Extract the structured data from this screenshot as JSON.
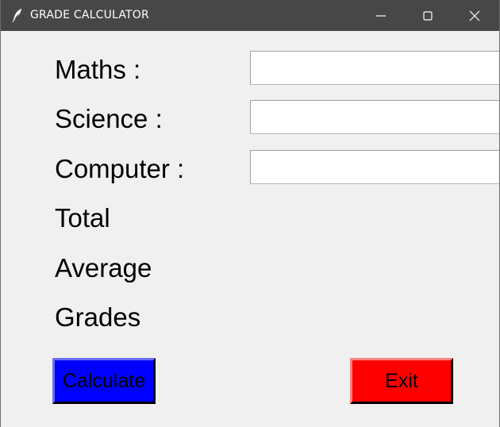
{
  "window": {
    "title": "GRADE CALCULATOR"
  },
  "form": {
    "maths_label": "Maths :",
    "science_label": "Science :",
    "computer_label": "Computer :",
    "total_label": "Total",
    "average_label": "Average",
    "grades_label": "Grades",
    "maths_value": "",
    "science_value": "",
    "computer_value": ""
  },
  "buttons": {
    "calculate_label": "Calculate",
    "exit_label": "Exit"
  },
  "colors": {
    "calculate_bg": "#0000ff",
    "exit_bg": "#ff0000",
    "window_bg": "#f0f0f0",
    "titlebar_bg": "#474747"
  }
}
